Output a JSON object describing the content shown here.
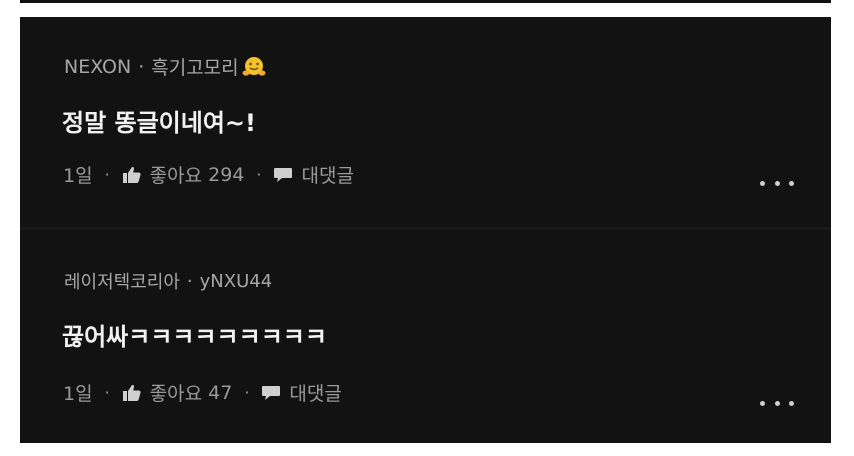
{
  "comments": [
    {
      "author": "NEXON",
      "handle": "흑기고모리",
      "handle_emoji": "hugging-face-icon",
      "text": "정말 똥글이네여~!",
      "time": "1일",
      "like_label": "좋아요",
      "like_count": "294",
      "reply_label": "대댓글"
    },
    {
      "author": "레이저텍코리아",
      "handle": "yNXU44",
      "text": "끊어싸ㅋㅋㅋㅋㅋㅋㅋㅋㅋ",
      "time": "1일",
      "like_label": "좋아요",
      "like_count": "47",
      "reply_label": "대댓글"
    }
  ],
  "separator": "·",
  "colors": {
    "panel_bg": "#121212",
    "text": "#f1f1f1",
    "meta": "#9a9a9a"
  }
}
